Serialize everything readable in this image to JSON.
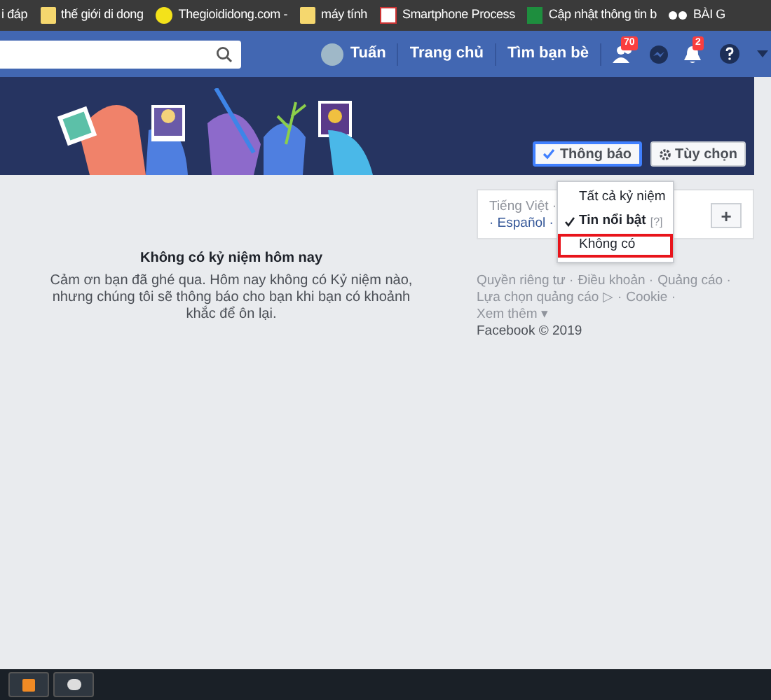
{
  "bookmarks": [
    {
      "label": "i đáp",
      "kind": "none"
    },
    {
      "label": "thế giới di dong",
      "kind": "folder"
    },
    {
      "label": "Thegioididong.com -",
      "kind": "site"
    },
    {
      "label": "máy tính",
      "kind": "folder"
    },
    {
      "label": "Smartphone Process",
      "kind": "page"
    },
    {
      "label": "Cập nhật thông tin b",
      "kind": "sheet"
    },
    {
      "label": "BÀI G",
      "kind": "eyes"
    }
  ],
  "navbar": {
    "user": "Tuấn",
    "links": [
      "Trang chủ",
      "Tìm bạn bè"
    ],
    "friend_requests": "70",
    "notifications": "2"
  },
  "banner": {
    "buttons": [
      {
        "label": "Thông báo",
        "selected": true,
        "kind": "check"
      },
      {
        "label": "Tùy chọn",
        "selected": false,
        "kind": "gear"
      }
    ]
  },
  "dropdown": [
    {
      "label": "Tất cả kỷ niệm",
      "checked": false,
      "highlighted": false
    },
    {
      "label": "Tin nổi bật",
      "checked": true,
      "highlighted": false,
      "help": "[?]"
    },
    {
      "label": "Không có",
      "checked": false,
      "highlighted": true
    }
  ],
  "empty_state": {
    "title": "Không có kỷ niệm hôm nay",
    "body": "Cảm ơn bạn đã ghé qua. Hôm nay không có Kỷ niệm nào, nhưng chúng tôi sẽ thông báo cho bạn khi bạn có khoảnh khắc để ôn lại."
  },
  "languages": {
    "items": [
      "Tiếng Việt ·",
      "· Español ·"
    ],
    "add": "+"
  },
  "footer": {
    "lines": [
      [
        "Quyền riêng tư ·",
        "Điều khoản ·",
        "Quảng cáo ·"
      ],
      [
        "Lựa chọn quảng cáo ▷ ·",
        "Cookie ·"
      ],
      [
        "Xem thêm ▾"
      ]
    ],
    "copyright": "Facebook © 2019"
  }
}
